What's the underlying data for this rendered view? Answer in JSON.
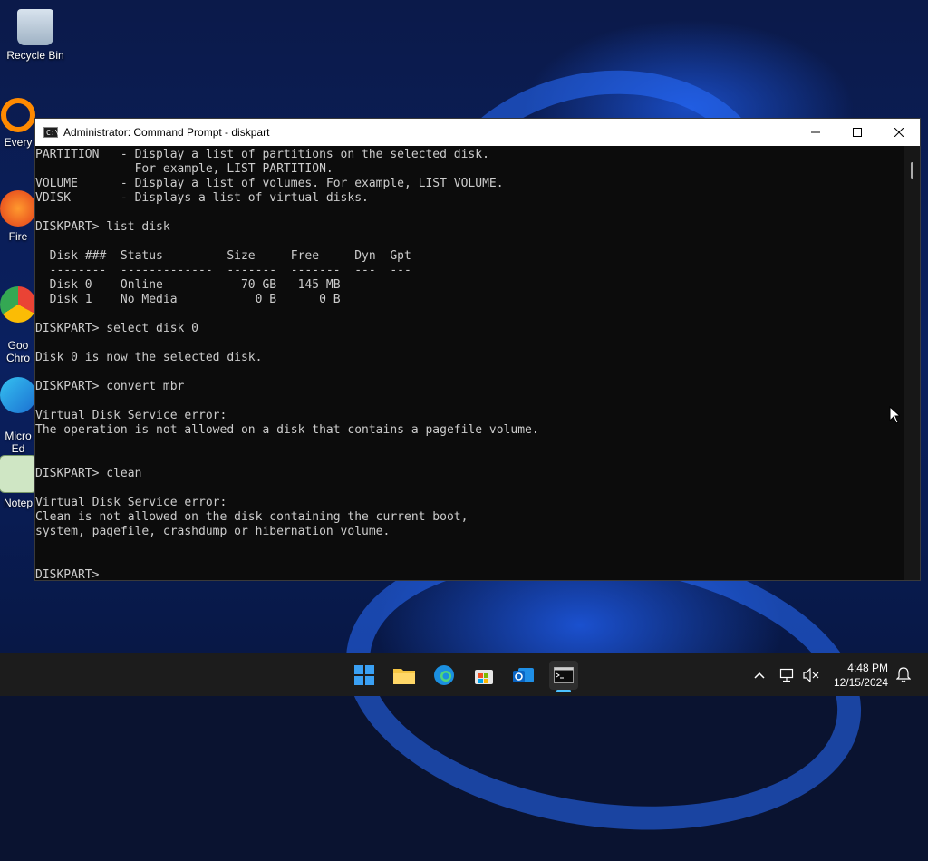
{
  "desktop": {
    "icons": [
      {
        "label": "Recycle Bin"
      },
      {
        "label": "Every"
      },
      {
        "label": "Fire"
      },
      {
        "label": "Goo\nChro"
      },
      {
        "label": "Micro\nEd"
      },
      {
        "label": "Notep"
      }
    ]
  },
  "window": {
    "title": "Administrator: Command Prompt - diskpart",
    "app_icon_text": "C:\\_",
    "console_lines": [
      "PARTITION   - Display a list of partitions on the selected disk.",
      "              For example, LIST PARTITION.",
      "VOLUME      - Display a list of volumes. For example, LIST VOLUME.",
      "VDISK       - Displays a list of virtual disks.",
      "",
      "DISKPART> list disk",
      "",
      "  Disk ###  Status         Size     Free     Dyn  Gpt",
      "  --------  -------------  -------  -------  ---  ---",
      "  Disk 0    Online           70 GB   145 MB",
      "  Disk 1    No Media           0 B      0 B",
      "",
      "DISKPART> select disk 0",
      "",
      "Disk 0 is now the selected disk.",
      "",
      "DISKPART> convert mbr",
      "",
      "Virtual Disk Service error:",
      "The operation is not allowed on a disk that contains a pagefile volume.",
      "",
      "",
      "DISKPART> clean",
      "",
      "Virtual Disk Service error:",
      "Clean is not allowed on the disk containing the current boot,",
      "system, pagefile, crashdump or hibernation volume.",
      "",
      "",
      "DISKPART> "
    ]
  },
  "taskbar": {
    "apps": [
      "start-icon",
      "file-explorer-icon",
      "edge-icon",
      "store-icon",
      "outlook-icon",
      "terminal-icon"
    ],
    "time": "4:48 PM",
    "date": "12/15/2024"
  },
  "colors": {
    "console_bg": "#0c0c0c",
    "console_text": "#cccccc",
    "taskbar_bg": "#1c1c1c",
    "accent": "#4cc2ff"
  }
}
